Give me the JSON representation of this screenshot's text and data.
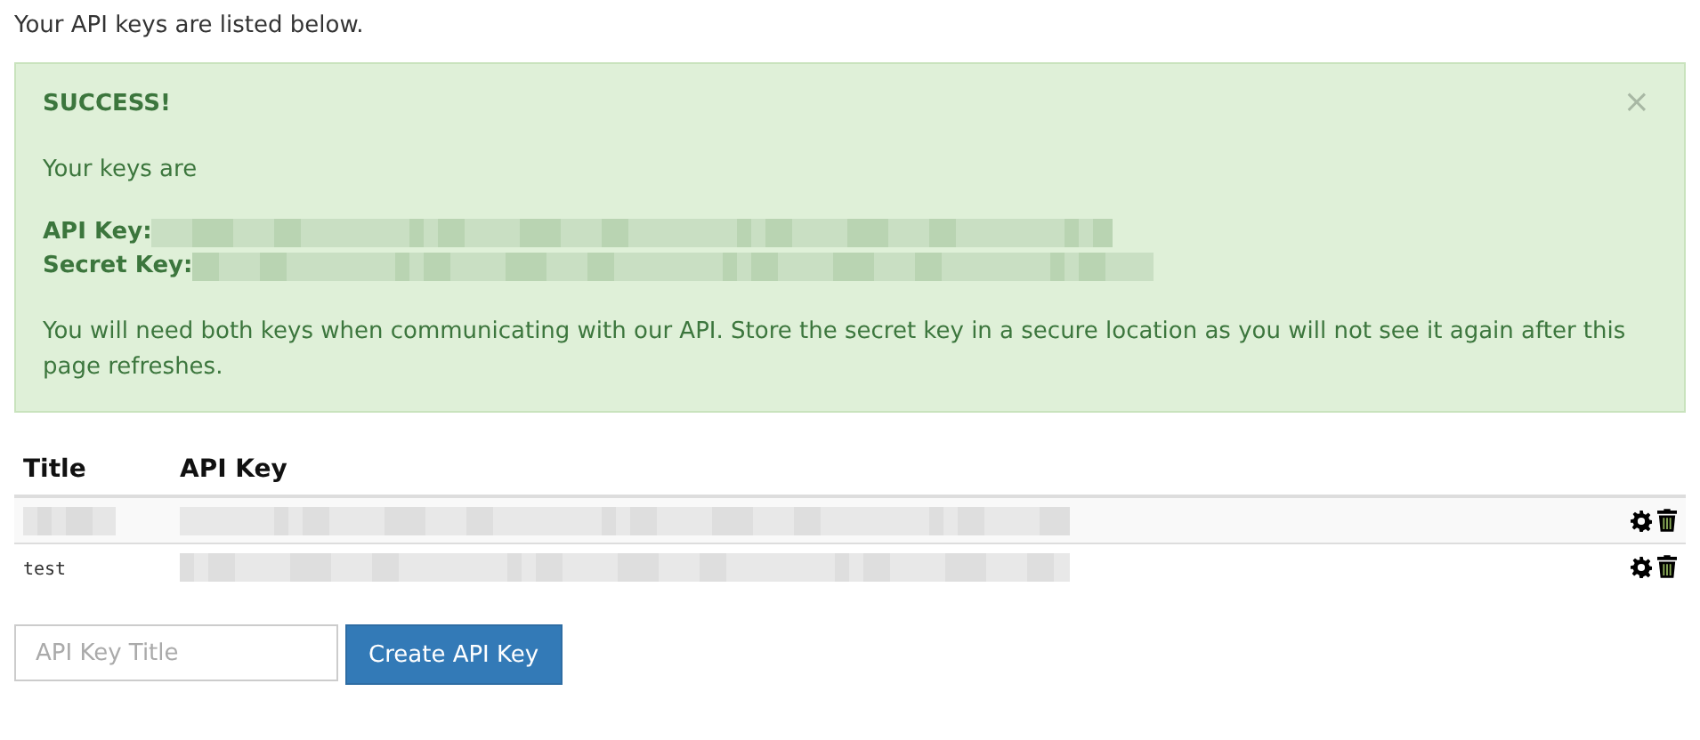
{
  "intro": "Your API keys are listed below.",
  "alert": {
    "heading": "SUCCESS!",
    "close": "×",
    "line": "Your keys are",
    "keys": [
      {
        "label": "API Key:"
      },
      {
        "label": "Secret Key:"
      }
    ],
    "note": "You will need both keys when communicating with our API. Store the secret key in a secure location as you will not see it again after this page refreshes."
  },
  "table": {
    "columns": [
      "Title",
      "API Key"
    ],
    "rows": [
      {
        "title_redacted": true
      },
      {
        "title_redacted": false,
        "title": "test"
      }
    ]
  },
  "form": {
    "placeholder": "API Key Title",
    "button": "Create API Key"
  }
}
